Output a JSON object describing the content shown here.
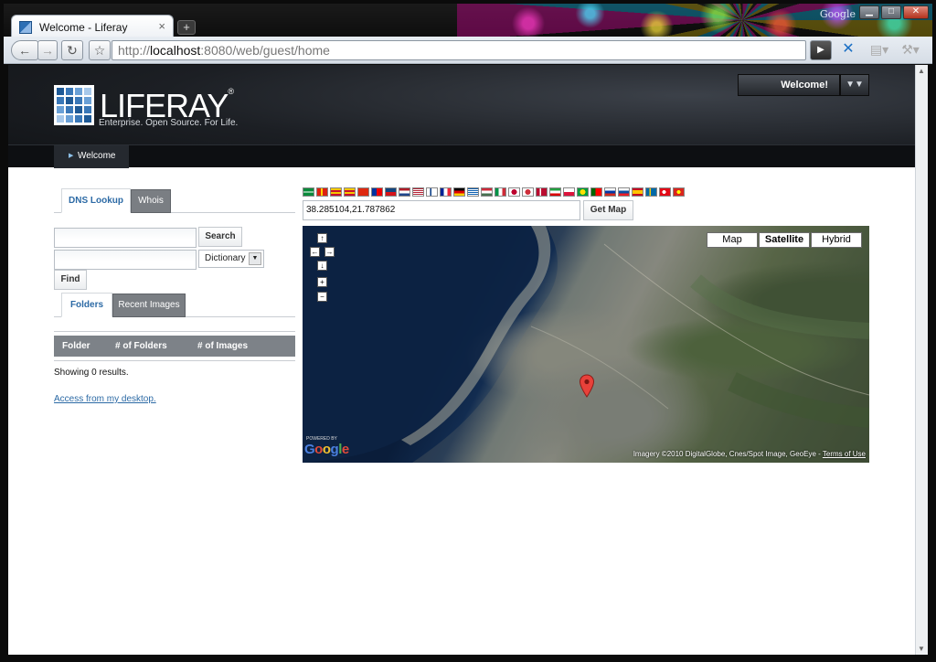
{
  "browser": {
    "tab_title": "Welcome - Liferay",
    "tab_close": "×",
    "new_tab": "+",
    "brand": "Google",
    "url_scheme": "http://",
    "url_host": "localhost",
    "url_rest": ":8080/web/guest/home"
  },
  "header": {
    "logo_text": "LIFERAY",
    "logo_mark": "®",
    "tagline": "Enterprise. Open Source. For Life.",
    "dock_label": "Welcome!"
  },
  "nav": {
    "items": [
      {
        "label": "Welcome"
      }
    ]
  },
  "dns_portlet": {
    "tabs": [
      {
        "label": "DNS Lookup"
      },
      {
        "label": "Whois"
      }
    ],
    "search_button": "Search",
    "dictionary_selected": "Dictionary",
    "find_button": "Find"
  },
  "image_portlet": {
    "tabs": [
      {
        "label": "Folders"
      },
      {
        "label": "Recent Images"
      }
    ],
    "columns": [
      "Folder",
      "# of Folders",
      "# of Images"
    ],
    "results": "Showing 0 results.",
    "desktop_link": "Access from my desktop."
  },
  "map_portlet": {
    "coordinates": "38.285104,21.787862",
    "get_map_button": "Get Map",
    "map_types": [
      "Map",
      "Satellite",
      "Hybrid"
    ],
    "selected_type": "Satellite",
    "powered_by": "POWERED BY",
    "google": "Google",
    "attribution": "Imagery ©2010 DigitalGlobe, Cnes/Spot Image, GeoEye - ",
    "terms": "Terms of Use"
  },
  "colors": {
    "header_dark": "#1c1f24",
    "link_blue": "#2c6aa5",
    "table_header": "#7d8288",
    "inactive_tab": "#7a7e83"
  },
  "icons": {
    "back": "back-arrow-icon",
    "forward": "forward-arrow-icon",
    "reload": "reload-icon",
    "star": "bookmark-star-icon",
    "pin": "map-marker-icon"
  }
}
